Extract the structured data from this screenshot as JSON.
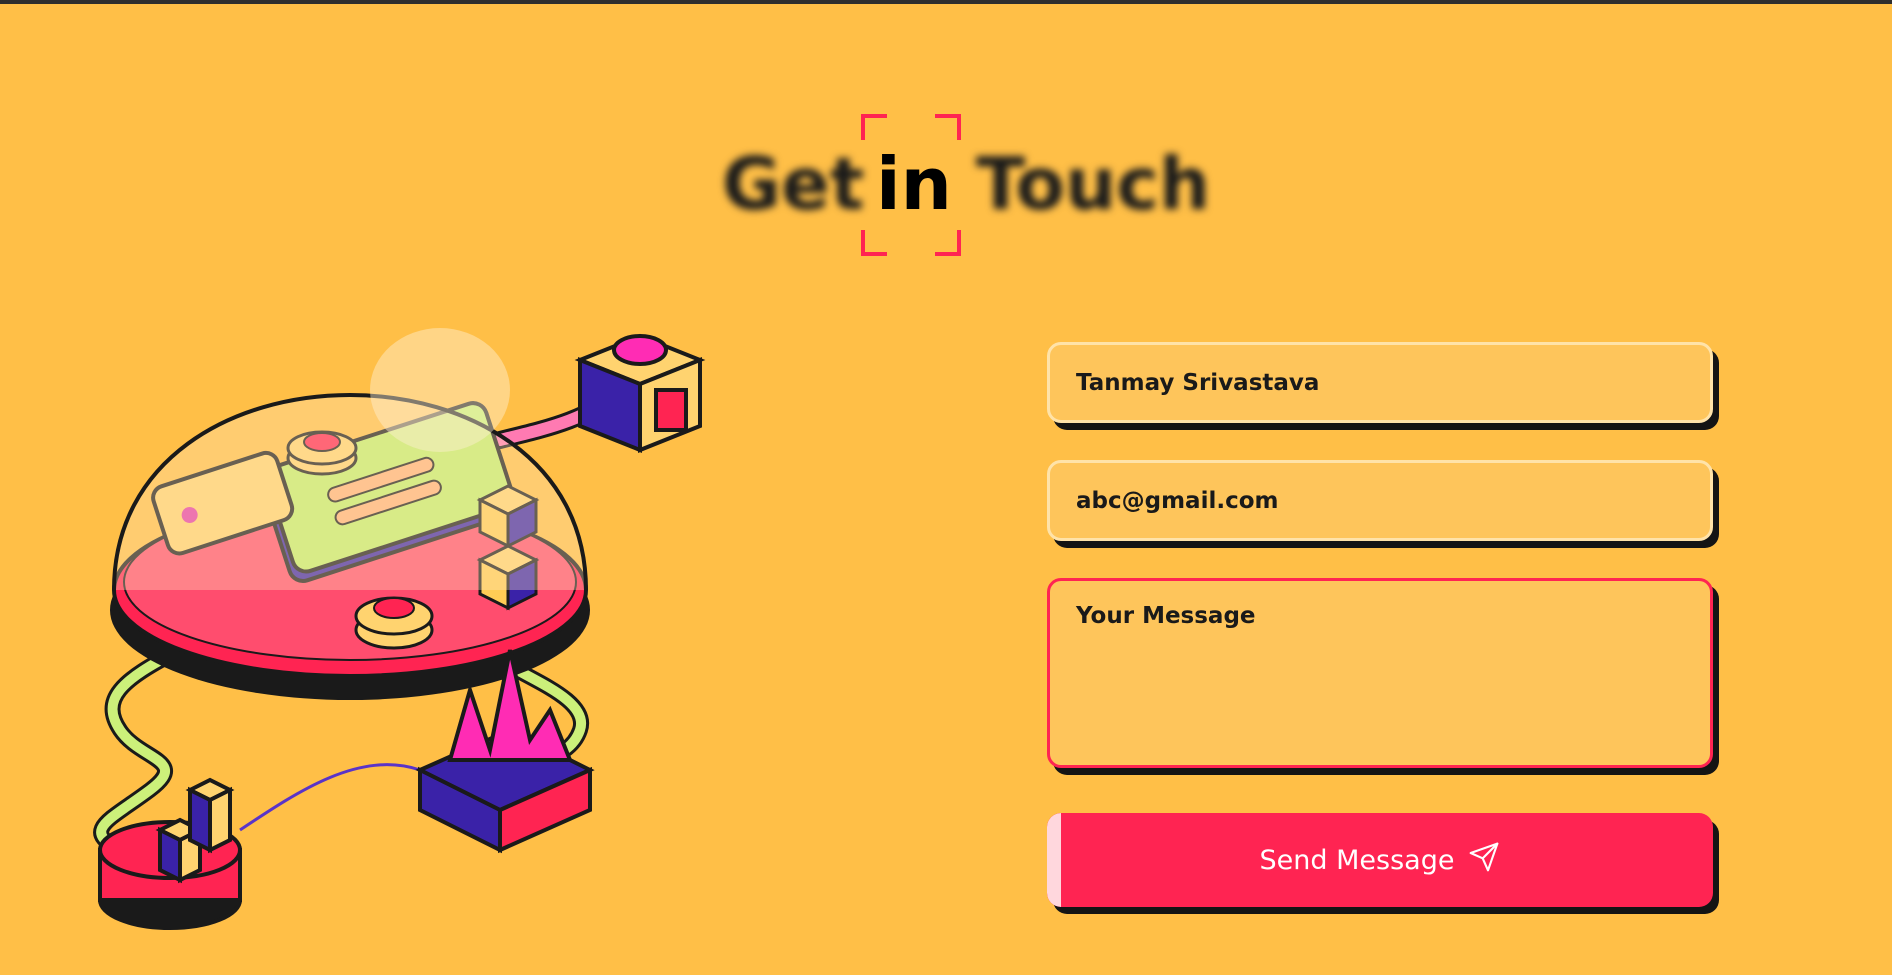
{
  "heading": {
    "word1": "Get",
    "word2": "in",
    "word3": "Touch"
  },
  "form": {
    "name_value": "Tanmay Srivastava",
    "email_value": "abc@gmail.com",
    "message_placeholder": "Your Message",
    "submit_label": "Send Message"
  },
  "icons": {
    "submit": "send-plane-icon"
  },
  "colors": {
    "background": "#ffbf47",
    "accent": "#ff2452",
    "field_bg": "#fec55b",
    "text": "#1a1a1a"
  }
}
